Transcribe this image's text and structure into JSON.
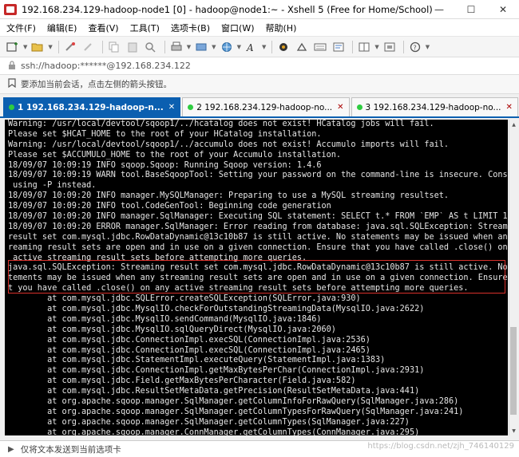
{
  "window": {
    "title": "192.168.234.129-hadoop-node1 [0] - hadoop@node1:~ - Xshell 5 (Free for Home/School)",
    "minimize": "—",
    "maximize": "☐",
    "close": "✕"
  },
  "menu": [
    "文件(F)",
    "编辑(E)",
    "查看(V)",
    "工具(T)",
    "选项卡(B)",
    "窗口(W)",
    "帮助(H)"
  ],
  "address": {
    "icon": "ssh-lock-icon",
    "text": "ssh://hadoop:******@192.168.234.122"
  },
  "hint": {
    "text": "要添加当前会话，点击左侧的箭头按钮。"
  },
  "tabs": [
    {
      "number": "1",
      "label": "192.168.234.129-hadoop-n...",
      "active": true
    },
    {
      "number": "2",
      "label": "192.168.234.129-hadoop-no...",
      "active": false
    },
    {
      "number": "3",
      "label": "192.168.234.129-hadoop-no...",
      "active": false
    }
  ],
  "terminal": {
    "lines": [
      "Warning: /usr/local/devtool/sqoop1/../hcatalog does not exist! HCatalog jobs will fail.",
      "Please set $HCAT_HOME to the root of your HCatalog installation.",
      "Warning: /usr/local/devtool/sqoop1/../accumulo does not exist! Accumulo imports will fail.",
      "Please set $ACCUMULO_HOME to the root of your Accumulo installation.",
      "18/09/07 10:09:19 INFO sqoop.Sqoop: Running Sqoop version: 1.4.6",
      "18/09/07 10:09:19 WARN tool.BaseSqoopTool: Setting your password on the command-line is insecure. Consider",
      " using -P instead.",
      "18/09/07 10:09:20 INFO manager.MySQLManager: Preparing to use a MySQL streaming resultset.",
      "18/09/07 10:09:20 INFO tool.CodeGenTool: Beginning code generation",
      "18/09/07 10:09:20 INFO manager.SqlManager: Executing SQL statement: SELECT t.* FROM `EMP` AS t LIMIT 1",
      "18/09/07 10:09:20 ERROR manager.SqlManager: Error reading from database: java.sql.SQLException: Streaming",
      "result set com.mysql.jdbc.RowDataDynamic@13c10b87 is still active. No statements may be issued when any st",
      "reaming result sets are open and in use on a given connection. Ensure that you have called .close() on any",
      " active streaming result sets before attempting more queries.",
      "java.sql.SQLException: Streaming result set com.mysql.jdbc.RowDataDynamic@13c10b87 is still active. No sta",
      "tements may be issued when any streaming result sets are open and in use on a given connection. Ensure tha",
      "t you have called .close() on any active streaming result sets before attempting more queries.",
      "        at com.mysql.jdbc.SQLError.createSQLException(SQLError.java:930)",
      "        at com.mysql.jdbc.MysqlIO.checkForOutstandingStreamingData(MysqlIO.java:2622)",
      "        at com.mysql.jdbc.MysqlIO.sendCommand(MysqlIO.java:1846)",
      "        at com.mysql.jdbc.MysqlIO.sqlQueryDirect(MysqlIO.java:2060)",
      "        at com.mysql.jdbc.ConnectionImpl.execSQL(ConnectionImpl.java:2536)",
      "        at com.mysql.jdbc.ConnectionImpl.execSQL(ConnectionImpl.java:2465)",
      "        at com.mysql.jdbc.StatementImpl.executeQuery(StatementImpl.java:1383)",
      "        at com.mysql.jdbc.ConnectionImpl.getMaxBytesPerChar(ConnectionImpl.java:2931)",
      "        at com.mysql.jdbc.Field.getMaxBytesPerCharacter(Field.java:582)",
      "        at com.mysql.jdbc.ResultSetMetaData.getPrecision(ResultSetMetaData.java:441)",
      "        at org.apache.sqoop.manager.SqlManager.getColumnInfoForRawQuery(SqlManager.java:286)",
      "        at org.apache.sqoop.manager.SqlManager.getColumnTypesForRawQuery(SqlManager.java:241)",
      "        at org.apache.sqoop.manager.SqlManager.getColumnTypes(SqlManager.java:227)",
      "        at org.apache.sqoop.manager.ConnManager.getColumnTypes(ConnManager.java:295)"
    ]
  },
  "sendbar": {
    "text": "仅将文本发送到当前选项卡"
  },
  "watermark": "https://blog.csdn.net/zjh_746140129",
  "colors": {
    "accent": "#0b5fb0",
    "highlight_border": "#d9312b",
    "terminal_bg": "#000000"
  }
}
